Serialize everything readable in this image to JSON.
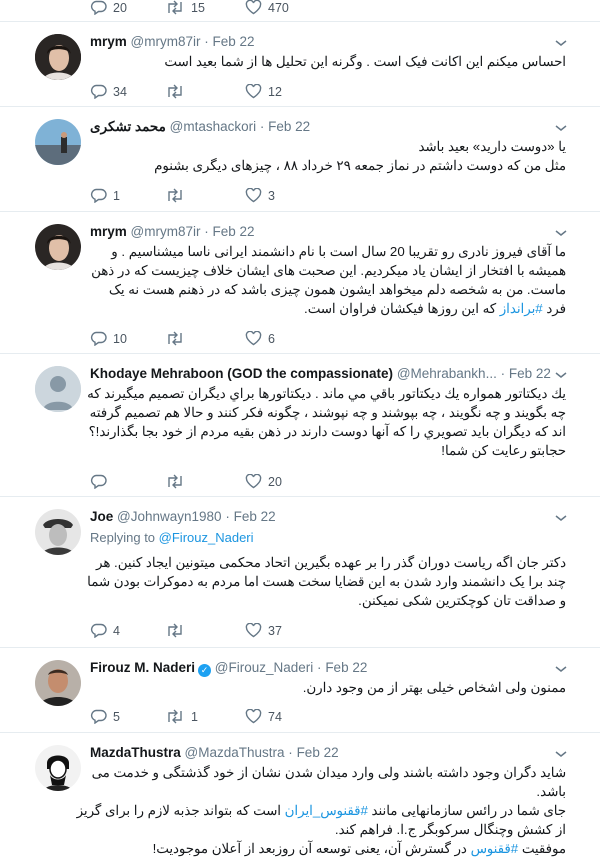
{
  "tweets": [
    {
      "id": "t0",
      "actions": {
        "reply": "20",
        "retweet": "15",
        "like": "470"
      }
    },
    {
      "id": "t1",
      "name": "mrym",
      "handle": "@mrym87ir",
      "date": "Feb 22",
      "lines": [
        "احساس میکنم این اکانت فیک است . وگرنه این تحلیل ها از شما بعید است"
      ],
      "actions": {
        "reply": "34",
        "retweet": "",
        "like": "12"
      }
    },
    {
      "id": "t2",
      "name": "محمد تشکری",
      "handle": "@mtashackori",
      "date": "Feb 22",
      "lines": [
        "یا «دوست دارید» بعید باشد",
        "مثل من که دوست داشتم در نماز جمعه ۲۹ خرداد ۸۸ ، چیزهای دیگری بشنوم"
      ],
      "actions": {
        "reply": "1",
        "retweet": "",
        "like": "3"
      }
    },
    {
      "id": "t3",
      "name": "mrym",
      "handle": "@mrym87ir",
      "date": "Feb 22",
      "lines": [
        "ما آقای فیروز نادری رو تقریبا 20 سال است با نام دانشمند ایرانی ناسا میشناسیم . و",
        "همیشه با افتخار از ایشان یاد میکردیم. این صحبت های ایشان خلاف چیزیست که در ذهن",
        "ماست. من به شخصه دلم میخواهد ایشون همون چیزی باشد که در ذهنم هست نه یک"
      ],
      "last_line_pre": "فرد ",
      "last_line_tag": "#برانداز",
      "last_line_post": " که این روزها فیکشان فراوان است.",
      "actions": {
        "reply": "10",
        "retweet": "",
        "like": "6"
      }
    },
    {
      "id": "t4",
      "name": "Khodaye Mehraboon (GOD the compassionate)",
      "handle": "@Mehrabankh...",
      "date": "Feb 22",
      "lines": [
        "يك ديكتاتور همواره يك ديكتاتور باقي مي ماند . ديكتاتورها براي ديگران تصميم ميگيرند كه",
        "چه بگويند و چه نگويند ، چه بپوشند و چه نپوشند ، چگونه فكر كنند و حالا هم تصميم گرفته",
        "اند كه ديگران بايد تصويري را كه آنها دوست دارند در ذهن بقيه مردم از خود بجا بگذارند!؟",
        "حجابتو رعايت كن شما!"
      ],
      "actions": {
        "reply": "",
        "retweet": "",
        "like": "20"
      }
    },
    {
      "id": "t5",
      "name": "Joe",
      "handle": "@Johnwayn1980",
      "date": "Feb 22",
      "replying_label": "Replying to",
      "replying_handle": "@Firouz_Naderi",
      "lines": [
        "دکتر جان اگه ریاست دوران گذر را بر عهده بگیرین اتحاد محکمی میتونین ایجاد کنین. هر",
        "چند برا یک دانشمند وارد شدن به این قضایا سخت هست اما مردم به دموکرات بودن شما",
        "و صداقت تان کوچکترین شکی نمیکنن."
      ],
      "actions": {
        "reply": "4",
        "retweet": "",
        "like": "37"
      }
    },
    {
      "id": "t6",
      "name": "Firouz M. Naderi",
      "handle": "@Firouz_Naderi",
      "date": "Feb 22",
      "verified_mark": "✓",
      "lines": [
        "ممنون ولی اشخاص خیلی بهتر از من وجود دارن."
      ],
      "actions": {
        "reply": "5",
        "retweet": "1",
        "like": "74"
      }
    },
    {
      "id": "t7",
      "name": "MazdaThustra",
      "handle": "@MazdaThustra",
      "date": "Feb 22",
      "lines": [
        "شاید دگران وجود داشته باشند ولی وارد میدان شدن نشان از خود گذشتگی و خدمت می",
        "باشد."
      ],
      "line3_pre": "جای شما در رائس سازمانهایی مانند ",
      "line3_tag": "#ققنوس_ایران",
      "line3_post": " است که بتواند جذبه لازم را برای گریز",
      "line4": "از کشش وچنگال سرکوبگر ج.ا. فراهم کند.",
      "line5_pre": "موفقیت ",
      "line5_tag": "#ققنوس",
      "line5_post": " در گسترش آن، یعنی توسعه آن روزبعد از آعلان موجودیت!"
    }
  ]
}
